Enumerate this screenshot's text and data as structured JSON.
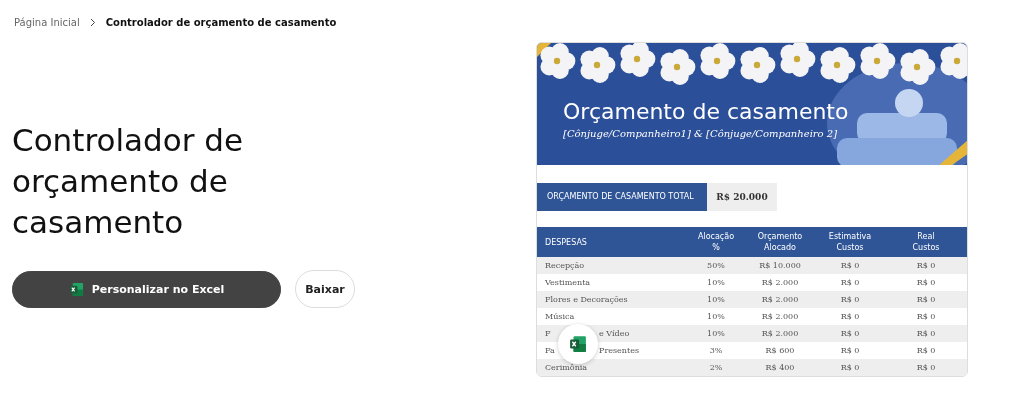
{
  "breadcrumb": [
    {
      "label": "Página Inicial",
      "current": false
    },
    {
      "label": "Controlador de orçamento de casamento",
      "current": true
    }
  ],
  "title": "Controlador de orçamento de casamento",
  "buttons": [
    {
      "kind": "primary",
      "label": "Personalizar no Excel"
    },
    {
      "kind": "secondary",
      "label": "Baixar"
    }
  ],
  "preview": {
    "banner": {
      "title": "Orçamento de casamento",
      "subtitle": "[Cônjuge/Companheiro1] & [Cônjuge/Companheiro 2]"
    },
    "total": {
      "label": "ORÇAMENTO DE CASAMENTO TOTAL",
      "value": "R$ 20.000"
    },
    "columns": [
      "DESPESAS",
      "Alocação %",
      "Orçamento Alocado",
      "Estimativa Custos",
      "Real Custos"
    ],
    "rows": [
      {
        "cells": [
          "Recepção",
          "50%",
          "R$ 10.000",
          "R$ 0",
          "R$ 0"
        ]
      },
      {
        "cells": [
          "Vestimenta",
          "10%",
          "R$ 2.000",
          "R$ 0",
          "R$ 0"
        ]
      },
      {
        "cells": [
          "Flores e Decorações",
          "10%",
          "R$ 2.000",
          "R$ 0",
          "R$ 0"
        ]
      },
      {
        "cells": [
          "Música",
          "10%",
          "R$ 2.000",
          "R$ 0",
          "R$ 0"
        ]
      },
      {
        "cells": [
          "F",
          "10%",
          "R$ 2.000",
          "R$ 0",
          "R$ 0"
        ],
        "covered_tail": "e Vídeo"
      },
      {
        "cells": [
          "Fa",
          "3%",
          "R$ 600",
          "R$ 0",
          "R$ 0"
        ],
        "covered_tail": "Presentes"
      },
      {
        "cells": [
          "Cerimônia",
          "2%",
          "R$ 400",
          "R$ 0",
          "R$ 0"
        ]
      }
    ]
  }
}
